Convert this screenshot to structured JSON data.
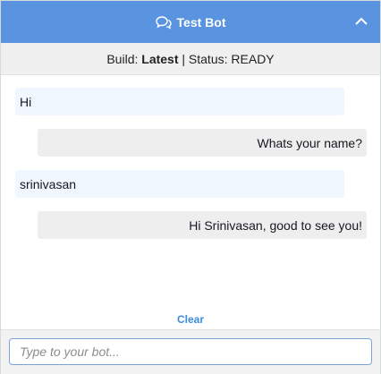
{
  "header": {
    "title": "Test Bot",
    "chat_icon": "chat-bubbles-icon",
    "collapse_icon": "chevron-up-icon"
  },
  "status_bar": {
    "build_label": "Build:",
    "build_value": "Latest",
    "separator": "|",
    "status_label": "Status:",
    "status_value": "READY"
  },
  "messages": [
    {
      "sender": "user",
      "text": "Hi"
    },
    {
      "sender": "bot",
      "text": "Whats your name?"
    },
    {
      "sender": "user",
      "text": "srinivasan"
    },
    {
      "sender": "bot",
      "text": "Hi Srinivasan, good to see you!"
    }
  ],
  "clear_label": "Clear",
  "input": {
    "value": "",
    "placeholder": "Type to your bot..."
  },
  "colors": {
    "header_bg": "#5a94e0",
    "user_bubble": "#f1f7fe",
    "bot_bubble": "#eeeeee",
    "link": "#3a8dde"
  }
}
